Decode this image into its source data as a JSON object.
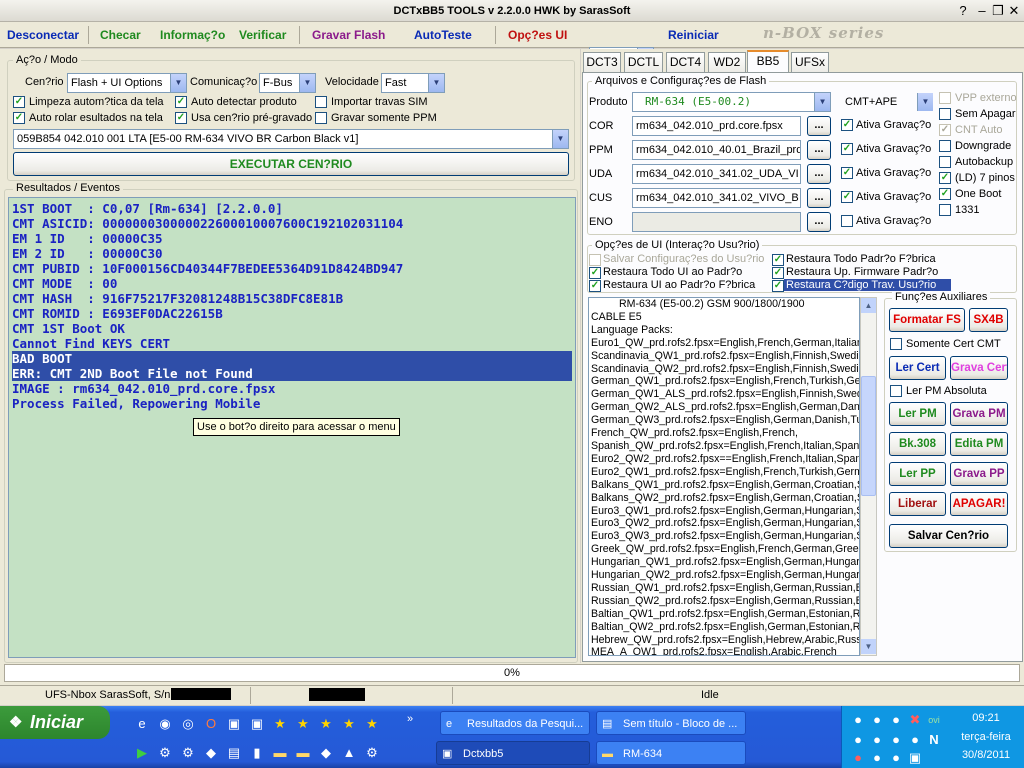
{
  "window": {
    "title": "DCTxBB5 TOOLS v 2.2.0.0 HWK by SarasSoft"
  },
  "toolbar": {
    "disconnect": "Desconectar",
    "check": "Checar",
    "info": "Informaç?o",
    "verify": "Verificar",
    "flash": "Gravar Flash",
    "autotest": "AutoTeste",
    "ui_options": "Opç?es UI",
    "combo_value": "?",
    "restart": "Reiniciar",
    "logo": "n-BOX series"
  },
  "action": {
    "group_title": "Aç?o / Modo",
    "scenario_label": "Cen?rio",
    "scenario_value": "Flash + UI Options",
    "comm_label": "Comunicaç?o",
    "comm_value": "F-Bus",
    "speed_label": "Velocidade",
    "speed_value": "Fast",
    "cb_clean": "Limpeza autom?tica da tela",
    "cb_autodetect": "Auto detectar produto",
    "cb_import": "Importar travas SIM",
    "cb_autoscroll": "Auto rolar esultados na tela",
    "cb_use_preset": "Usa cen?rio pré-gravado",
    "cb_ppm_only": "Gravar somente PPM",
    "preset_value": "059B854 042.010 001 LTA [E5-00 RM-634 VIVO BR Carbon Black v1]",
    "execute": "EXECUTAR CEN?RIO"
  },
  "results": {
    "group_title": "Resultados / Eventos",
    "lines": [
      "1ST BOOT  : C0,07 [Rm-634] [2.2.0.0]",
      "CMT ASICID: 000000030000022600010007600C192102031104",
      "EM 1 ID   : 00000C35",
      "EM 2 ID   : 00000C30",
      "CMT PUBID : 10F000156CD40344F7BEDEE5364D91D8424BD947",
      "CMT MODE  : 00",
      "CMT HASH  : 916F75217F32081248B15C38DFC8E81B",
      "CMT ROMID : E693EF0DAC22615B",
      "CMT 1ST Boot OK",
      "Cannot Find KEYS CERT",
      "BAD BOOT",
      "ERR: CMT 2ND Boot File not Found",
      "IMAGE : rm634_042.010_prd.core.fpsx",
      "Process Failed, Repowering Mobile"
    ],
    "tooltip": "Use o bot?o direito para acessar o menu"
  },
  "tabs": [
    "DCT3",
    "DCTL",
    "DCT4",
    "WD2",
    "BB5",
    "UFSx"
  ],
  "files": {
    "group_title": "Arquivos e Configuraç?es de Flash",
    "product_label": "Produto",
    "product_value": "RM-634  (E5-00.2)",
    "mode_value": "CMT+APE",
    "rows": [
      {
        "label": "COR",
        "value": "rm634_042.010_prd.core.fpsx",
        "flash": "Ativa Gravaç?o"
      },
      {
        "label": "PPM",
        "value": "rm634_042.010_40.01_Brazil_prd.",
        "flash": "Ativa Gravaç?o"
      },
      {
        "label": "UDA",
        "value": "rm634_042.010_341.02_UDA_VI",
        "flash": "Ativa Gravaç?o"
      },
      {
        "label": "CUS",
        "value": "rm634_042.010_341.02_VIVO_B",
        "flash": "Ativa Gravaç?o"
      },
      {
        "label": "ENO",
        "value": "",
        "flash": "Ativa Gravaç?o"
      }
    ],
    "browse": "...",
    "opts": [
      "VPP externo",
      "Sem Apagar",
      "CNT Auto",
      "Downgrade",
      "Autobackup",
      "(LD) 7 pinos",
      "One Boot",
      "1331"
    ]
  },
  "ui_opts": {
    "group_title": "Opç?es de UI (Interaç?o Usu?rio)",
    "save_cfg": "Salvar Configuraç?es do Usu?rio",
    "restore_all_factory": "Restaura Todo Padr?o F?brica",
    "restore_ui_default": "Restaura Todo UI ao Padr?o",
    "restore_fw": "Restaura Up. Firmware Padr?o",
    "restore_ui_factory": "Restaura UI ao Padr?o F?brica",
    "restore_code": "Restaura C?digo Trav. Usu?rio"
  },
  "info": {
    "header": "RM-634 (E5-00.2) GSM 900/1800/1900",
    "lines": [
      "CABLE E5",
      "Language Packs:",
      "Euro1_QW_prd.rofs2.fpsx=English,French,German,Italian",
      "Scandinavia_QW1_prd.rofs2.fpsx=English,Finnish,Swedis",
      "Scandinavia_QW2_prd.rofs2.fpsx=English,Finnish,Swedis",
      "German_QW1_prd.rofs2.fpsx=English,French,Turkish,Ger",
      "German_QW1_ALS_prd.rofs2.fpsx=English,Finnish,Swed",
      "German_QW2_ALS_prd.rofs2.fpsx=English,German,Danis",
      "German_QW3_prd.rofs2.fpsx=English,German,Danish,Tu",
      "French_QW_prd.rofs2.fpsx=English,French,",
      "Spanish_QW_prd.rofs2.fpsx=English,French,Italian,Spani",
      "Euro2_QW2_prd.rofs2.fpsx==English,French,Italian,Span",
      "Euro2_QW1_prd.rofs2.fpsx=English,French,Turkish,Germ",
      "Balkans_QW1_prd.rofs2.fpsx=English,German,Croatian,S",
      "Balkans_QW2_prd.rofs2.fpsx=English,German,Croatian,S",
      "Euro3_QW1_prd.rofs2.fpsx=English,German,Hungarian,S",
      "Euro3_QW2_prd.rofs2.fpsx=English,German,Hungarian,S",
      "Euro3_QW3_prd.rofs2.fpsx=English,German,Hungarian,S",
      "Greek_QW_prd.rofs2.fpsx=English,French,German,Greek",
      "Hungarian_QW1_prd.rofs2.fpsx=English,German,Hungari",
      "Hungarian_QW2_prd.rofs2.fpsx=English,German,Hungari",
      "Russian_QW1_prd.rofs2.fpsx=English,German,Russian,B",
      "Russian_QW2_prd.rofs2.fpsx=English,German,Russian,B",
      "Baltian_QW1_prd.rofs2.fpsx=English,German,Estonian,R",
      "Baltian_QW2_prd.rofs2.fpsx=English,German,Estonian,R",
      "Hebrew_QW_prd.rofs2.fpsx=English,Hebrew,Arabic,Russ",
      "MEA_A_QW1_prd.rofs2.fpsx=English,Arabic,French"
    ]
  },
  "aux": {
    "group_title": "Funç?es Auxiliares",
    "format_fs": "Formatar FS",
    "sx4b": "SX4B",
    "only_cert_cmt": "Somente Cert CMT",
    "read_cert": "Ler Cert",
    "write_cert": "Grava Cert",
    "read_pm_abs": "Ler PM Absoluta",
    "read_pm": "Ler PM",
    "write_pm": "Grava PM",
    "bk308": "Bk.308",
    "edit_pm": "Edita PM",
    "read_pp": "Ler PP",
    "write_pp": "Grava PP",
    "unlock": "Liberar",
    "erase": "APAGAR!",
    "save_scenario": "Salvar Cen?rio"
  },
  "status": {
    "progress_label": "0%",
    "progress": 0,
    "serial_label": "UFS-Nbox SarasSoft, S/n:",
    "state": "Idle"
  },
  "taskbar": {
    "start": "Iniciar",
    "tasks": [
      "Resultados da Pesqui...",
      "Sem título - Bloco de ...",
      "Dctxbb5",
      "RM-634"
    ],
    "time": "09:21",
    "day": "terça-feira",
    "date": "30/8/2011"
  },
  "colors": {
    "accent_blue": "#0a2bb5",
    "green_text": "#1f8a1f",
    "purple": "#8b1a8b",
    "red": "#e00000",
    "log_bg": "#c4e1c4"
  }
}
